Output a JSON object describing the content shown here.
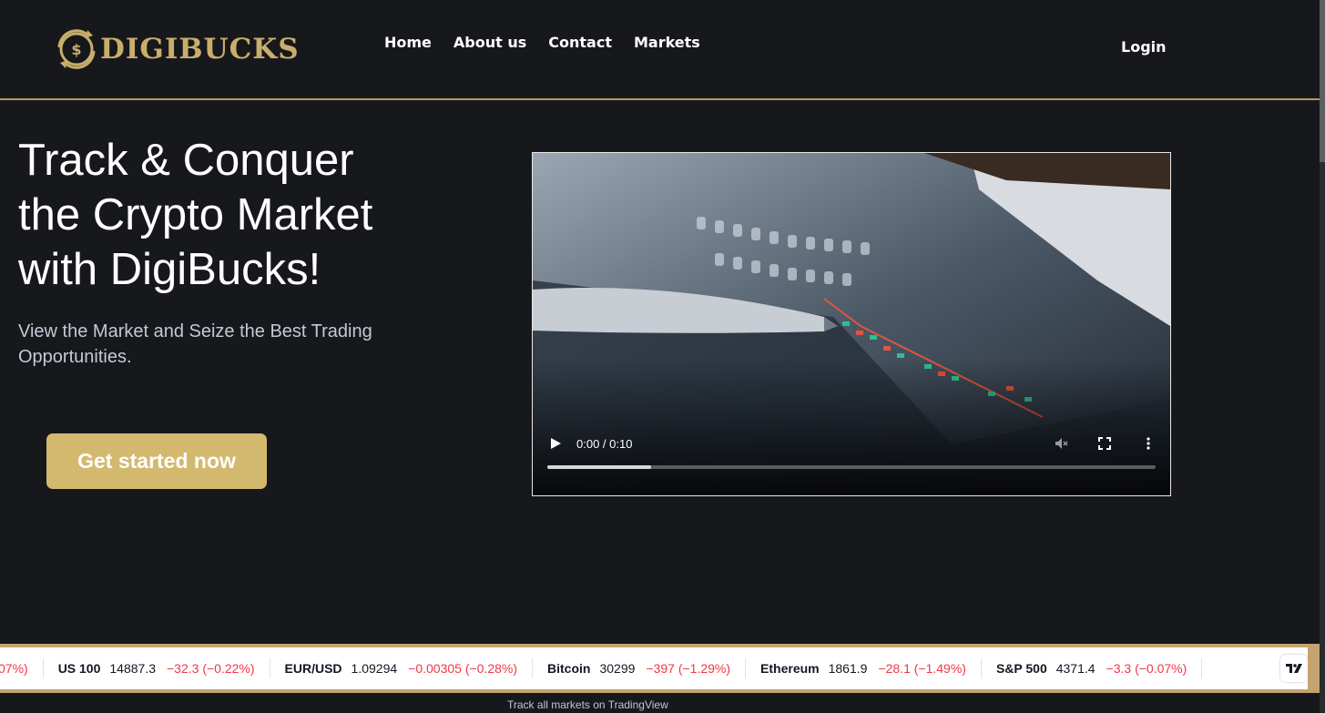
{
  "brand": {
    "name": "DIGIBUCKS",
    "accent": "#c9ad6b"
  },
  "nav": {
    "items": [
      {
        "label": "Home"
      },
      {
        "label": "About us"
      },
      {
        "label": "Contact"
      },
      {
        "label": "Markets"
      }
    ],
    "login": "Login"
  },
  "hero": {
    "title_lines": [
      "Track & Conquer",
      "the Crypto Market",
      "with DigiBucks!"
    ],
    "subtitle": "View the Market and Seize the Best Trading Opportunities.",
    "cta": "Get started now"
  },
  "video": {
    "time": "0:00 / 0:10",
    "progress_fraction": 0.17
  },
  "ticker": {
    "leading_fragment": "07%)",
    "items": [
      {
        "name": "US 100",
        "price": "14887.3",
        "change": "−32.3 (−0.22%)"
      },
      {
        "name": "EUR/USD",
        "price": "1.09294",
        "change": "−0.00305 (−0.28%)"
      },
      {
        "name": "Bitcoin",
        "price": "30299",
        "change": "−397 (−1.29%)"
      },
      {
        "name": "Ethereum",
        "price": "1861.9",
        "change": "−28.1 (−1.49%)"
      },
      {
        "name": "S&P 500",
        "price": "4371.4",
        "change": "−3.3 (−0.07%)"
      }
    ],
    "negative_color": "#f23645"
  },
  "footer": {
    "tradingview_link": "Track all markets on TradingView"
  }
}
